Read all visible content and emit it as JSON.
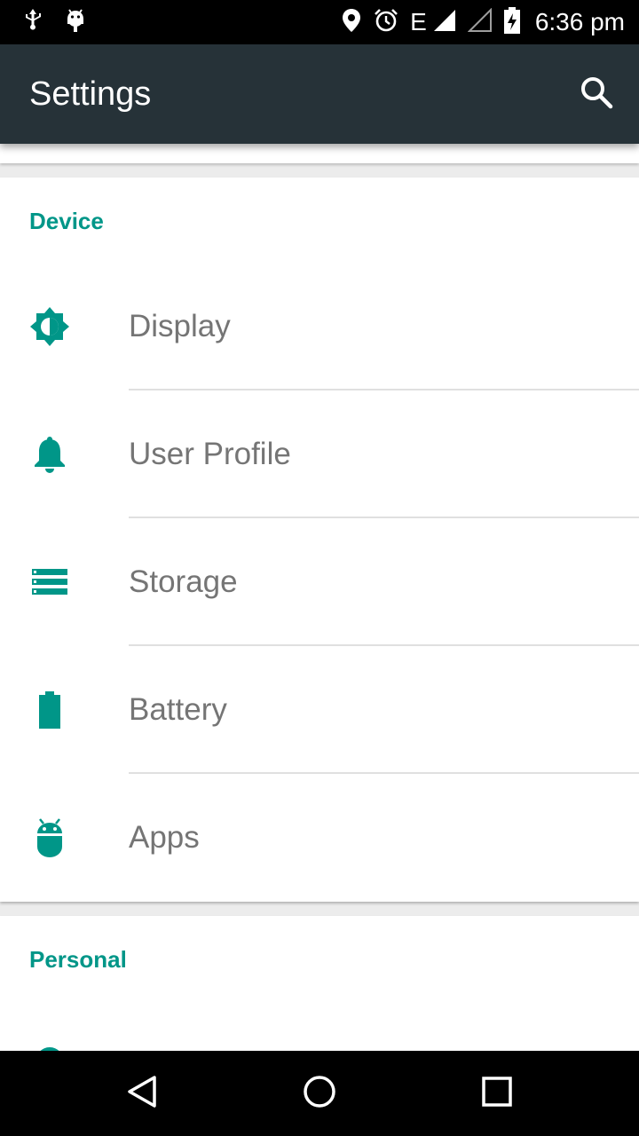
{
  "status_bar": {
    "time": "6:36 pm",
    "network_type": "E",
    "icons": [
      "usb-icon",
      "android-debug-icon",
      "location-icon",
      "alarm-icon",
      "signal-icon",
      "signal-empty-icon",
      "battery-charging-icon"
    ]
  },
  "toolbar": {
    "title": "Settings",
    "search_icon": "search-icon"
  },
  "sections": {
    "device": {
      "header": "Device",
      "items": [
        {
          "label": "Display",
          "icon": "brightness-icon"
        },
        {
          "label": "User Profile",
          "icon": "bell-icon"
        },
        {
          "label": "Storage",
          "icon": "storage-icon"
        },
        {
          "label": "Battery",
          "icon": "battery-icon"
        },
        {
          "label": "Apps",
          "icon": "android-icon"
        }
      ]
    },
    "personal": {
      "header": "Personal"
    }
  },
  "nav_bar": {
    "buttons": [
      "back-icon",
      "home-icon",
      "recents-icon"
    ]
  },
  "colors": {
    "accent": "#009688",
    "toolbar": "#263238",
    "status_bar": "#000000",
    "item_text": "#757575"
  }
}
